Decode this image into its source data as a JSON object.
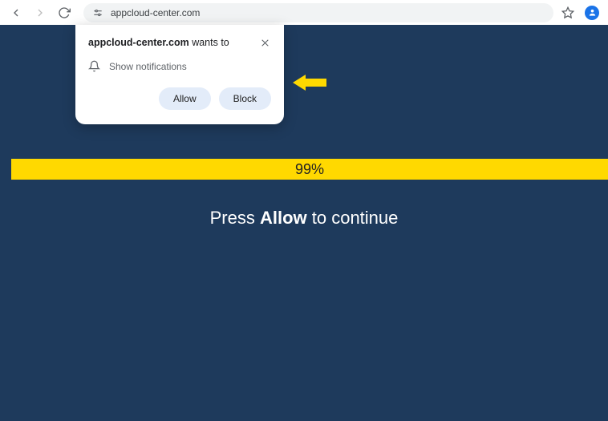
{
  "browser": {
    "url": "appcloud-center.com"
  },
  "popup": {
    "domain": "appcloud-center.com",
    "wants_to": " wants to",
    "permission_label": "Show notifications",
    "allow_label": "Allow",
    "block_label": "Block"
  },
  "page": {
    "progress_text": "99%",
    "instruction_prefix": "Press ",
    "instruction_bold": "Allow",
    "instruction_suffix": " to continue"
  },
  "colors": {
    "page_bg": "#1e3a5c",
    "accent_yellow": "#ffd900",
    "button_fill": "#e3ecf9"
  }
}
